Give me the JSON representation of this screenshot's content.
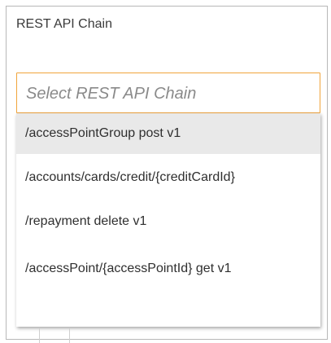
{
  "field": {
    "label": "REST API Chain",
    "placeholder": "Select REST API Chain"
  },
  "dropdown": {
    "options": [
      {
        "label": "/accessPointGroup post v1",
        "highlighted": true
      },
      {
        "label": "/accounts/cards/credit/{creditCardId}",
        "highlighted": false
      },
      {
        "label": "/repayment delete v1",
        "highlighted": false
      },
      {
        "label": "/accessPoint/{accessPointId} get v1",
        "highlighted": false
      }
    ]
  },
  "colors": {
    "focus_border": "#f0a43c",
    "highlight_bg": "#e9e9e9",
    "placeholder_text": "#8a8a8a"
  }
}
